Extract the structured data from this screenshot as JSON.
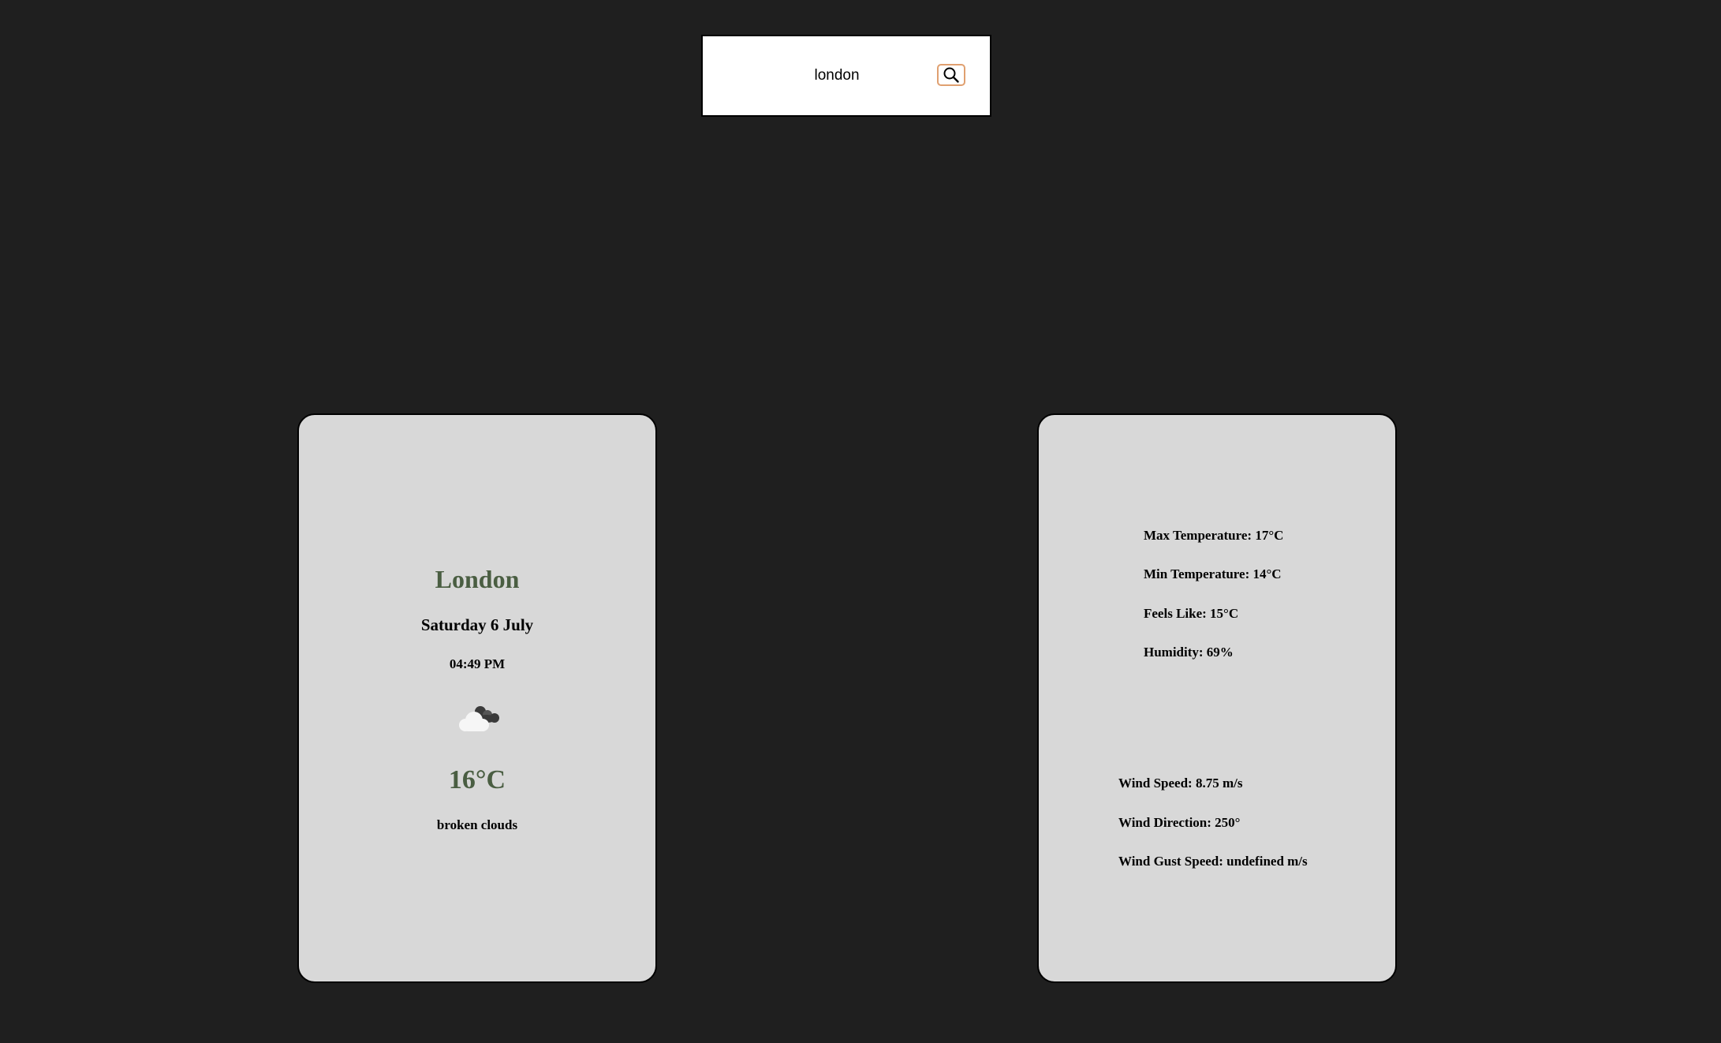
{
  "search": {
    "value": "london",
    "button_icon": "search-icon"
  },
  "current": {
    "city": "London",
    "date": "Saturday 6 July",
    "time": "04:49 PM",
    "icon": "broken-clouds-icon",
    "temperature": "16°C",
    "description": "broken clouds"
  },
  "details": {
    "max_temp": "Max Temperature: 17°C",
    "min_temp": "Min Temperature: 14°C",
    "feels_like": "Feels Like: 15°C",
    "humidity": "Humidity: 69%",
    "wind_speed": "Wind Speed: 8.75 m/s",
    "wind_direction": "Wind Direction: 250°",
    "wind_gust": "Wind Gust Speed: undefined m/s"
  },
  "colors": {
    "background": "#1f1f1f",
    "card": "#d8d8d8",
    "accent_green": "#4a5e42",
    "button_border": "#e0a070"
  }
}
